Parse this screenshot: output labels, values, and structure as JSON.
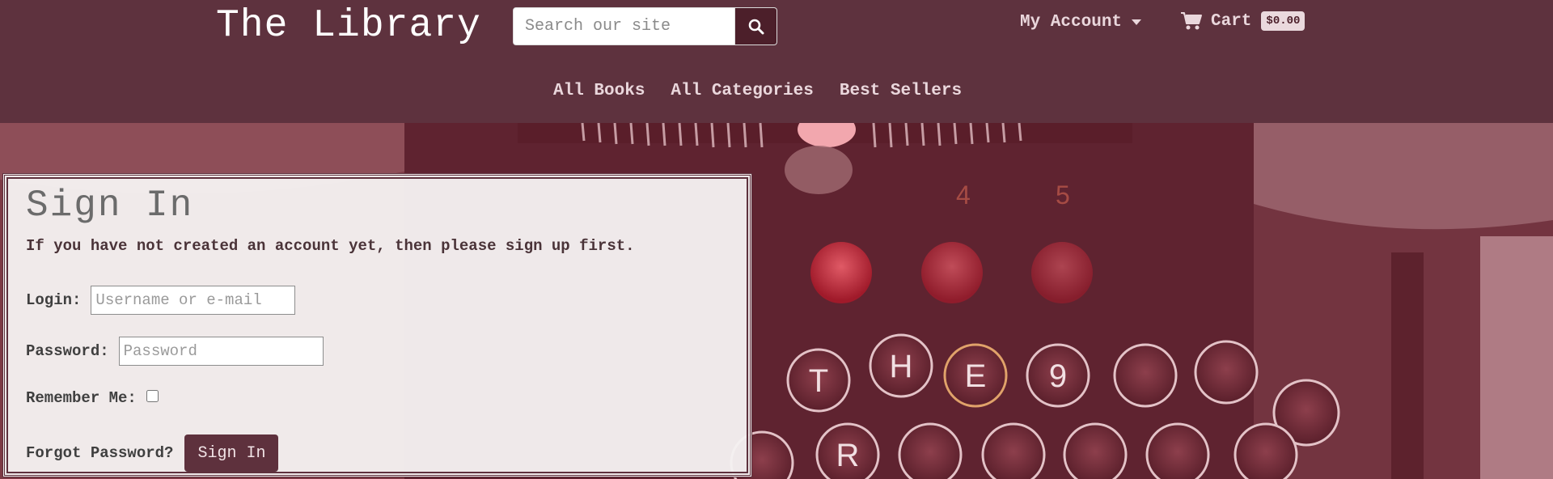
{
  "header": {
    "brand": "The Library",
    "search": {
      "placeholder": "Search our site",
      "icon": "search-icon"
    },
    "account_label": "My Account",
    "cart": {
      "label": "Cart",
      "amount": "$0.00",
      "icon": "shopping-cart-icon"
    },
    "nav": [
      "All Books",
      "All Categories",
      "Best Sellers"
    ]
  },
  "signin": {
    "title": "Sign In",
    "note": "If you have not created an account yet, then please sign up first.",
    "login_label": "Login:",
    "login_placeholder": "Username or e-mail",
    "password_label": "Password:",
    "password_placeholder": "Password",
    "remember_label": "Remember Me:",
    "forgot_label": "Forgot Password?",
    "submit_label": "Sign In"
  },
  "colors": {
    "header_bg": "#5e323e",
    "button_bg": "#4c1f2a",
    "accent_text": "#ead7dc"
  }
}
